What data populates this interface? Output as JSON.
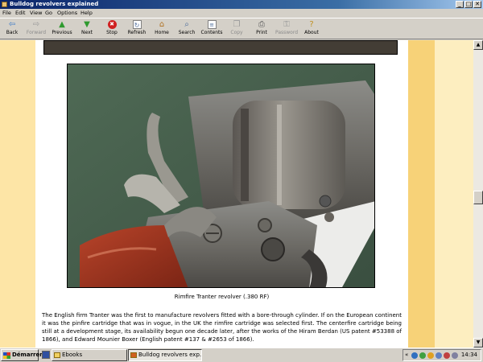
{
  "window": {
    "title": "Bulldog revolvers explained",
    "min_label": "_",
    "max_label": "□",
    "close_label": "✕"
  },
  "menu": [
    "File",
    "Edit",
    "View",
    "Go",
    "Options",
    "Help"
  ],
  "toolbar": [
    {
      "label": "Back",
      "icon": "back-arrow-icon",
      "color": "#3a7ac8",
      "enabled": true
    },
    {
      "label": "Forward",
      "icon": "forward-arrow-icon",
      "color": "#9a9a9a",
      "enabled": false
    },
    {
      "label": "Previous",
      "icon": "up-arrow-icon",
      "color": "#2e9a2e",
      "enabled": true
    },
    {
      "label": "Next",
      "icon": "down-arrow-icon",
      "color": "#2e9a2e",
      "enabled": true
    },
    {
      "label": "Stop",
      "icon": "stop-icon",
      "color": "#d02020",
      "enabled": true
    },
    {
      "label": "Refresh",
      "icon": "refresh-icon",
      "color": "#4a6a9a",
      "enabled": true
    },
    {
      "label": "Home",
      "icon": "home-icon",
      "color": "#b07020",
      "enabled": true
    },
    {
      "label": "Search",
      "icon": "search-icon",
      "color": "#4a6a9a",
      "enabled": true
    },
    {
      "label": "Contents",
      "icon": "contents-icon",
      "color": "#4a6a9a",
      "enabled": true
    },
    {
      "label": "Copy",
      "icon": "copy-icon",
      "color": "#9a9a9a",
      "enabled": false
    },
    {
      "label": "Print",
      "icon": "print-icon",
      "color": "#5a5a5a",
      "enabled": true
    },
    {
      "label": "Password",
      "icon": "key-icon",
      "color": "#9a9a9a",
      "enabled": false
    },
    {
      "label": "About",
      "icon": "about-icon",
      "color": "#c09020",
      "enabled": true
    }
  ],
  "content": {
    "caption": "Rimfire Tranter revolver (.380 RF)",
    "paragraph": "The English firm Tranter was the first to manufacture revolvers fitted with a bore-through cylinder. If on the European continent it was the pinfire cartridge that was in vogue, in the UK the rimfire cartridge was selected first. The centerfire cartridge being still at a development stage, its availability begun one decade later, after the works of the Hiram Berdan (US patent #53388 of 1866), and Edward Mounier Boxer (English patent #137 & #2653 of 1866)."
  },
  "taskbar": {
    "start_label": "Démarrer",
    "buttons": [
      {
        "label": "Ebooks",
        "active": false
      },
      {
        "label": "Bulldog revolvers exp...",
        "active": true
      }
    ],
    "tray_expand": "«",
    "clock": "14:34"
  },
  "colors": {
    "page_bg": "#ffffff",
    "strip_light": "#fde5a6",
    "strip_gold": "#f7d278",
    "titlebar": "#0a246a"
  }
}
